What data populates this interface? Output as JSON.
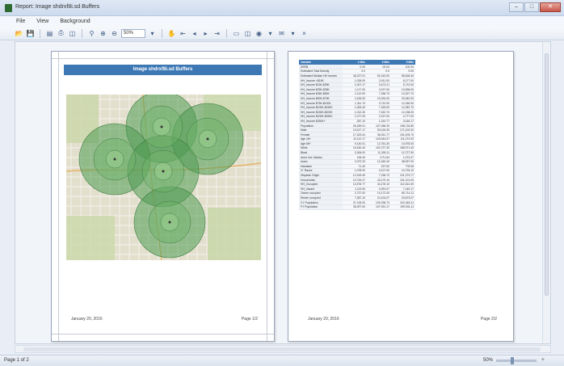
{
  "window": {
    "title": "Report: Image shdrxf8i.sd Buffers",
    "minimize_label": "–",
    "maximize_label": "□",
    "close_label": "✕"
  },
  "menu": {
    "items": [
      "File",
      "View",
      "Background"
    ]
  },
  "toolbar": {
    "zoom_value": "50%"
  },
  "page1": {
    "banner_title": "Image shdrxf8i.sd Buffers",
    "footer_date": "January 20, 2016",
    "footer_page": "Page 1/2"
  },
  "page2": {
    "footer_date": "January 20, 2016",
    "footer_page": "Page 2/2",
    "table": {
      "headers": [
        "Variable",
        "1 Mile",
        "3 Mile",
        "5 Mile"
      ],
      "rows": [
        [
          "Label",
          "1 Mile",
          "3 Mile",
          "5 Mile"
        ],
        [
          "SSRB",
          "0.00",
          "00.00",
          "100.00"
        ],
        [
          "Estimated Total Density",
          "0.0",
          "0.0",
          "0.00"
        ],
        [
          "Estimated Median HH Income",
          "46,227.01",
          "52,143.00",
          "55,618.40"
        ],
        [
          "HH_Income <$15K",
          "1,028.00",
          "3,011.00",
          "8,177.00"
        ],
        [
          "HH_Income $15K-$25K",
          "1,007.17",
          "3,473.21",
          "5,712.00"
        ],
        [
          "HH_Income $25K-$35K",
          "1,117.00",
          "3,197.00",
          "10,536.00"
        ],
        [
          "HH_Income $35K-$50K",
          "2,112.00",
          "7,186.70",
          "13,157.70"
        ],
        [
          "HH_Income $50K-$75K",
          "2,426.00",
          "10,034.00",
          "20,062.00"
        ],
        [
          "HH_Income $75K-$100K",
          "1,311.70",
          "3,710.00",
          "12,180.00"
        ],
        [
          "HH_Income $100K-$150K",
          "1,063.40",
          "7,169.00",
          "12,282.70"
        ],
        [
          "HH_Income $150K-$200K",
          "1,012.30",
          "7,022.70",
          "12,138.00"
        ],
        [
          "HH_Income $200K-$250K",
          "1,077.03",
          "2,197.00",
          "4,777.00"
        ],
        [
          "HH_Income $250K+",
          "287.10",
          "1,010.77",
          "3,016.17"
        ],
        [
          "Population",
          "26,189.01",
          "107,096.30",
          "198,716.80"
        ],
        [
          "Male",
          "13,017.17",
          "53,116.30",
          "171,102.00"
        ],
        [
          "Female",
          "17,323.04",
          "56,011.77",
          "101,678.70"
        ],
        [
          "Age 18+",
          "12,112.17",
          "103,044.07",
          "111,272.00"
        ],
        [
          "Age 65+",
          "9,140.01",
          "12,761.30",
          "13,978.00"
        ],
        [
          "White",
          "15,182.40",
          "102,727.30",
          "186,971.40"
        ],
        [
          "Black",
          "2,006.00",
          "11,330.11",
          "12,727.90"
        ],
        [
          "Amer Ind / Alaska",
          "106.40",
          "173.110",
          "1,073.27"
        ],
        [
          "Asian",
          "2,072.23",
          "12,180.40",
          "38,097.00"
        ],
        [
          "Hawaiian",
          "71.40",
          "237.00",
          "778.06"
        ],
        [
          "2+ Races",
          "1,078.00",
          "3,107.00",
          "10,733.10"
        ],
        [
          "Hispanic Origin",
          "12,163.40",
          "7,136.72",
          "121,274.77"
        ],
        [
          "Households",
          "10,700.27",
          "43,179.10",
          "101,101.00"
        ],
        [
          "HH_Occupied",
          "10,576.77",
          "44,178.10",
          "112,161.00"
        ],
        [
          "HH_Vacant",
          "1,113.00",
          "4,091.07",
          "7,140.17"
        ],
        [
          "Owner occupied",
          "2,737.00",
          "10,172.00",
          "80,714.11"
        ],
        [
          "Renter occupied",
          "7,387.10",
          "24,104.07",
          "20,673.07"
        ],
        [
          "CY Population",
          "37,128.00",
          "109,238.70",
          "202,063.11"
        ],
        [
          "FY Population",
          "35,097.00",
          "107,091.17",
          "199,931.11"
        ]
      ]
    }
  },
  "status": {
    "page_indicator": "Page 1 of 2",
    "zoom": "50%"
  },
  "colors": {
    "banner": "#3d78b5",
    "buffer_fill": "#4f9a52"
  }
}
